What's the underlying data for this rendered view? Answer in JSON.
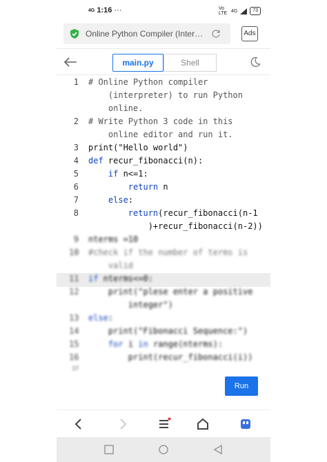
{
  "status_bar": {
    "network": "4G",
    "time": "1:16",
    "dots": "···",
    "lte": "Vo LTE",
    "net2": "4G",
    "battery": "73"
  },
  "browser": {
    "page_title": "Online Python Compiler (Inter…",
    "ads_label": "Ads"
  },
  "editor": {
    "tabs": [
      {
        "label": "main.py",
        "active": true
      },
      {
        "label": "Shell",
        "active": false
      }
    ],
    "run_label": "Run",
    "lines": [
      {
        "num": "1",
        "text": "# Online Python compiler"
      },
      {
        "num": "",
        "text": "    (interpreter) to run Python"
      },
      {
        "num": "",
        "text": "    online."
      },
      {
        "num": "2",
        "text": "# Write Python 3 code in this"
      },
      {
        "num": "",
        "text": "    online editor and run it."
      },
      {
        "num": "3",
        "text": "print(\"Hello world\")"
      },
      {
        "num": "4",
        "text": "def recur_fibonacci(n):"
      },
      {
        "num": "5",
        "text": "    if n<=1:"
      },
      {
        "num": "6",
        "text": "        return n"
      },
      {
        "num": "7",
        "text": "    else:"
      },
      {
        "num": "8",
        "text": "        return(recur_fibonacci(n-1"
      },
      {
        "num": "",
        "text": "            )+recur_fibonacci(n-2))"
      },
      {
        "num": "9",
        "text": "nterms =10"
      },
      {
        "num": "10",
        "text": "#check if the number of terms is"
      },
      {
        "num": "",
        "text": "    valid"
      },
      {
        "num": "11",
        "text": "if nterms<=0:"
      },
      {
        "num": "12",
        "text": "    print(\"plese enter a positive"
      },
      {
        "num": "",
        "text": "        integer\")"
      },
      {
        "num": "13",
        "text": "else:"
      },
      {
        "num": "14",
        "text": "    print(\"Fibonacci Sequence:\")"
      },
      {
        "num": "15",
        "text": "    for i in range(nterms):"
      },
      {
        "num": "16",
        "text": "        print(recur_fibonacci(i))"
      },
      {
        "num": "17",
        "text": ""
      }
    ]
  },
  "colors": {
    "accent": "#1a73e8",
    "shield": "#2fb344",
    "badge": "#e53935"
  }
}
